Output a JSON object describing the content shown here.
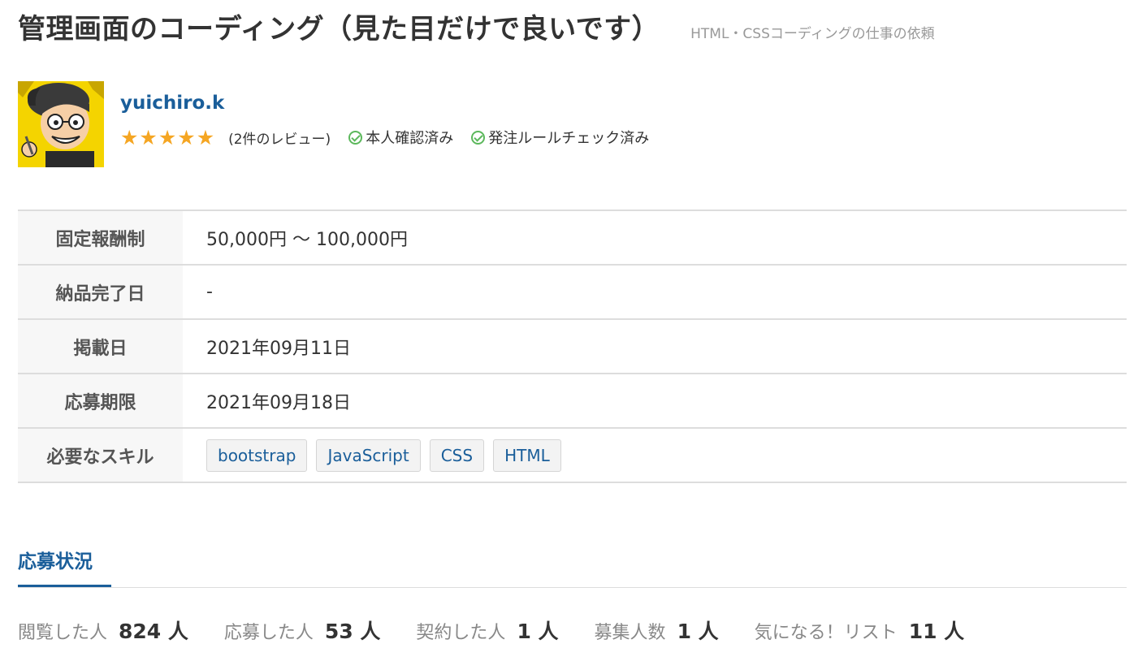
{
  "header": {
    "title": "管理画面のコーディング（見た目だけで良いです）",
    "category": "HTML・CSSコーディングの仕事の依頼"
  },
  "client": {
    "name": "yuichiro.k",
    "rating": 5,
    "review_count_text": "(2件のレビュー)",
    "badges": [
      "本人確認済み",
      "発注ルールチェック済み"
    ],
    "star_color": "#f5a623",
    "check_color": "#5cb85c"
  },
  "details": {
    "rows": [
      {
        "label": "固定報酬制",
        "value": "50,000円 〜 100,000円"
      },
      {
        "label": "納品完了日",
        "value": "-"
      },
      {
        "label": "掲載日",
        "value": "2021年09月11日"
      },
      {
        "label": "応募期限",
        "value": "2021年09月18日"
      },
      {
        "label": "必要なスキル",
        "value": ""
      }
    ],
    "skills": [
      "bootstrap",
      "JavaScript",
      "CSS",
      "HTML"
    ]
  },
  "status": {
    "tab_label": "応募状況",
    "stats": [
      {
        "label": "閲覧した人",
        "value": "824 人"
      },
      {
        "label": "応募した人",
        "value": "53 人"
      },
      {
        "label": "契約した人",
        "value": "1 人"
      },
      {
        "label": "募集人数",
        "value": "1 人"
      },
      {
        "label": "気になる！リスト",
        "value": "11 人"
      }
    ]
  },
  "colors": {
    "link": "#1a5e9a",
    "text": "#333333",
    "muted": "#999999"
  }
}
